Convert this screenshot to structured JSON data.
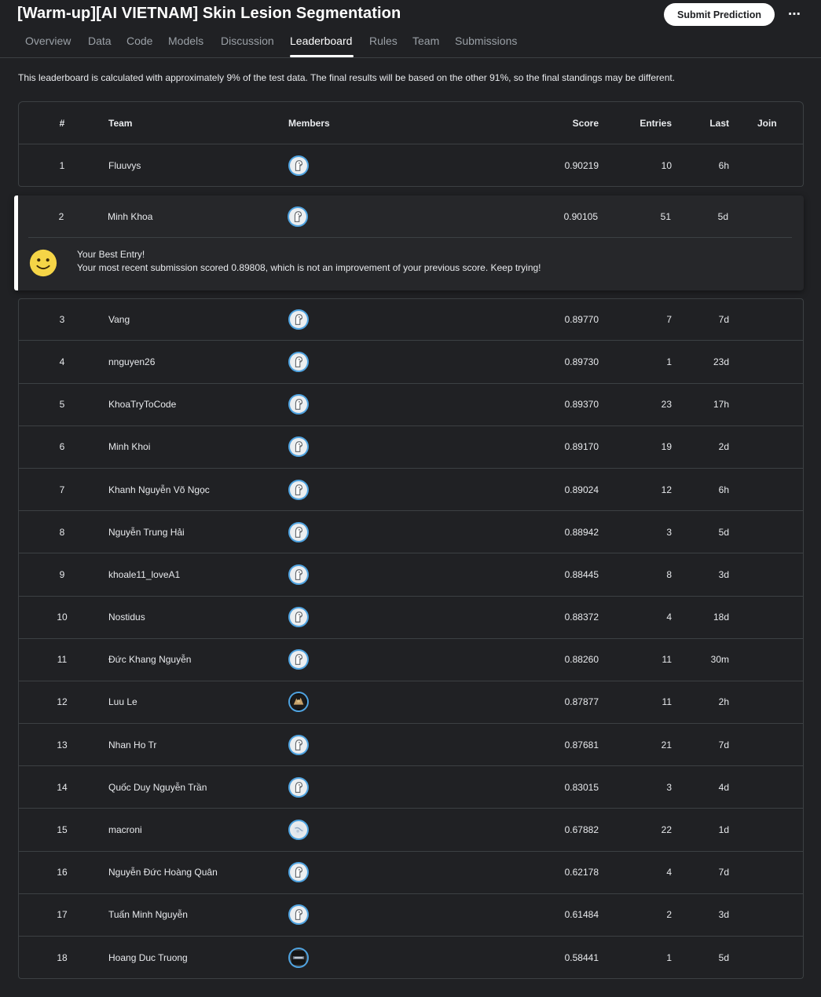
{
  "header": {
    "title": "[Warm-up][AI VIETNAM] Skin Lesion Segmentation",
    "submit_label": "Submit Prediction",
    "more_label": "⋯"
  },
  "tabs": [
    {
      "label": "Overview"
    },
    {
      "label": "Data"
    },
    {
      "label": "Code"
    },
    {
      "label": "Models"
    },
    {
      "label": "Discussion"
    },
    {
      "label": "Leaderboard"
    },
    {
      "label": "Rules"
    },
    {
      "label": "Team"
    },
    {
      "label": "Submissions"
    }
  ],
  "active_tab": "Leaderboard",
  "notice": "This leaderboard is calculated with approximately 9% of the test data. The final results will be based on the other 91%, so the final standings may be different.",
  "table": {
    "headers": {
      "rank": "#",
      "team": "Team",
      "members": "Members",
      "score": "Score",
      "entries": "Entries",
      "last": "Last",
      "join": "Join"
    },
    "rows": [
      {
        "rank": "1",
        "team": "Fluuvys",
        "score": "0.90219",
        "entries": "10",
        "last": "6h",
        "avatar": "default-avatar-icon"
      },
      {
        "rank": "2",
        "team": "Minh Khoa",
        "score": "0.90105",
        "entries": "51",
        "last": "5d",
        "avatar": "default-avatar-icon"
      },
      {
        "rank": "3",
        "team": "Vang",
        "score": "0.89770",
        "entries": "7",
        "last": "7d",
        "avatar": "default-avatar-icon"
      },
      {
        "rank": "4",
        "team": "nnguyen26",
        "score": "0.89730",
        "entries": "1",
        "last": "23d",
        "avatar": "default-avatar-icon"
      },
      {
        "rank": "5",
        "team": "KhoaTryToCode",
        "score": "0.89370",
        "entries": "23",
        "last": "17h",
        "avatar": "default-avatar-icon"
      },
      {
        "rank": "6",
        "team": "Minh Khoi",
        "score": "0.89170",
        "entries": "19",
        "last": "2d",
        "avatar": "default-avatar-icon"
      },
      {
        "rank": "7",
        "team": "Khanh Nguyễn Võ Ngọc",
        "score": "0.89024",
        "entries": "12",
        "last": "6h",
        "avatar": "default-avatar-icon"
      },
      {
        "rank": "8",
        "team": "Nguyễn Trung Hải",
        "score": "0.88942",
        "entries": "3",
        "last": "5d",
        "avatar": "default-avatar-icon"
      },
      {
        "rank": "9",
        "team": "khoale11_loveA1",
        "score": "0.88445",
        "entries": "8",
        "last": "3d",
        "avatar": "default-avatar-icon"
      },
      {
        "rank": "10",
        "team": "Nostidus",
        "score": "0.88372",
        "entries": "4",
        "last": "18d",
        "avatar": "default-avatar-icon"
      },
      {
        "rank": "11",
        "team": "Đức Khang Nguyễn",
        "score": "0.88260",
        "entries": "11",
        "last": "30m",
        "avatar": "default-avatar-icon"
      },
      {
        "rank": "12",
        "team": "Luu Le",
        "score": "0.87877",
        "entries": "11",
        "last": "2h",
        "avatar": "photo-avatar-icon"
      },
      {
        "rank": "13",
        "team": "Nhan Ho Tr",
        "score": "0.87681",
        "entries": "21",
        "last": "7d",
        "avatar": "default-avatar-icon"
      },
      {
        "rank": "14",
        "team": "Quốc Duy Nguyễn Trần",
        "score": "0.83015",
        "entries": "3",
        "last": "4d",
        "avatar": "default-avatar-icon"
      },
      {
        "rank": "15",
        "team": "macroni",
        "score": "0.67882",
        "entries": "22",
        "last": "1d",
        "avatar": "globe-avatar-icon"
      },
      {
        "rank": "16",
        "team": "Nguyễn Đức Hoàng Quân",
        "score": "0.62178",
        "entries": "4",
        "last": "7d",
        "avatar": "default-avatar-icon"
      },
      {
        "rank": "17",
        "team": "Tuấn Minh Nguyễn",
        "score": "0.61484",
        "entries": "2",
        "last": "3d",
        "avatar": "default-avatar-icon"
      },
      {
        "rank": "18",
        "team": "Hoang Duc Truong",
        "score": "0.58441",
        "entries": "1",
        "last": "5d",
        "avatar": "dark-avatar-icon"
      }
    ]
  },
  "my_entry": {
    "title": "Your Best Entry!",
    "message": "Your most recent submission scored 0.89808, which is not an improvement of your previous score. Keep trying!",
    "icon": "smiley-icon"
  },
  "colors": {
    "background": "#202124",
    "border": "#3c4043",
    "avatar_ring": "#4fa3e0",
    "smiley": "#f5d547"
  }
}
